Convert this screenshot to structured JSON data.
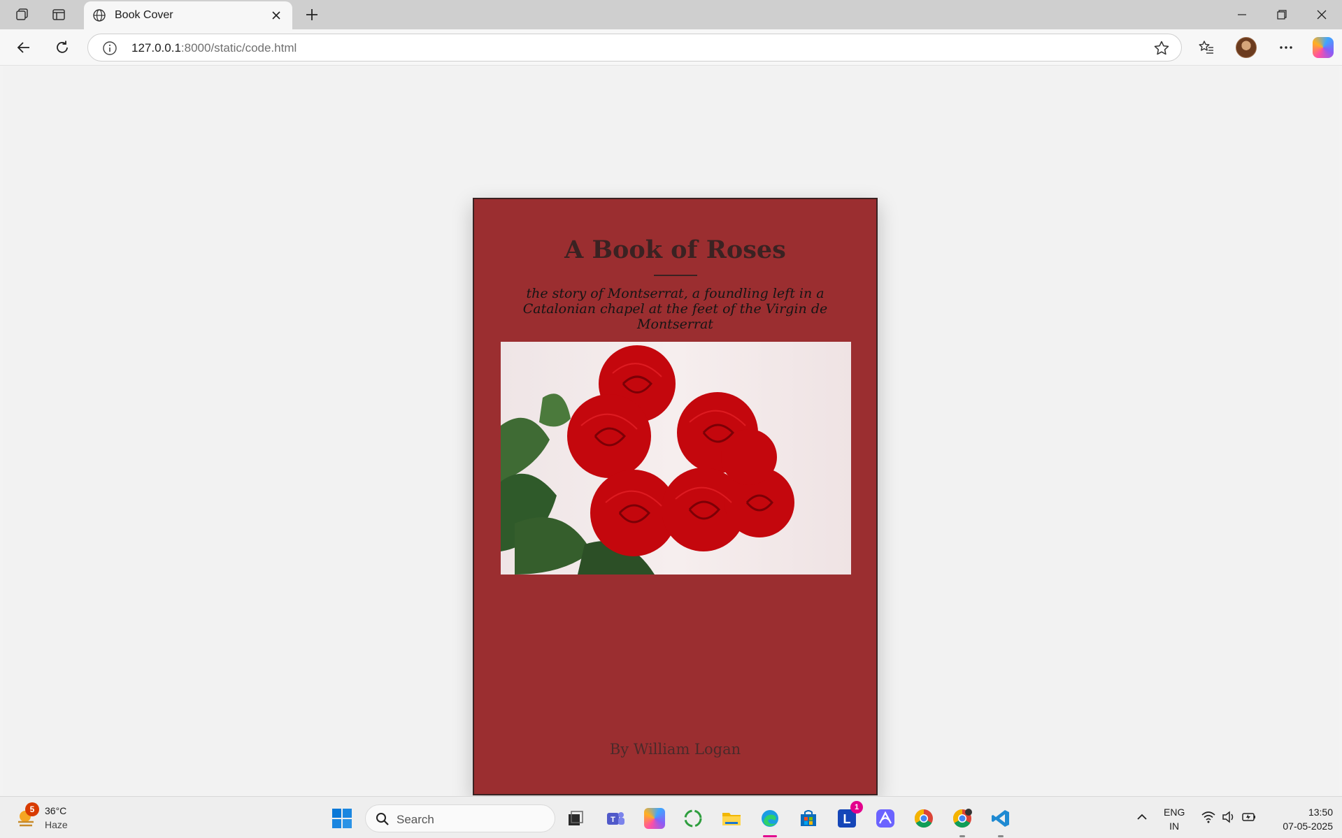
{
  "browser": {
    "tab": {
      "title": "Book Cover"
    },
    "address": {
      "host": "127.0.0.1",
      "rest": ":8000/static/code.html"
    }
  },
  "cover": {
    "background": "#9b2e30",
    "title": "A Book of Roses",
    "subtitle": "the story of Montserrat, a foundling left in a Catalonian chapel at the feet of the Virgin de Montserrat",
    "author": "By William Logan"
  },
  "taskbar": {
    "weather": {
      "badge": "5",
      "temp": "36°C",
      "condition": "Haze"
    },
    "search_placeholder": "Search",
    "apps": [
      {
        "name": "task-view-app",
        "badge": ""
      },
      {
        "name": "teams-app",
        "badge": ""
      },
      {
        "name": "copilot-app",
        "badge": ""
      },
      {
        "name": "sync-app",
        "badge": ""
      },
      {
        "name": "file-explorer-app",
        "badge": ""
      },
      {
        "name": "edge-app",
        "badge": ""
      },
      {
        "name": "store-app",
        "badge": ""
      },
      {
        "name": "l-app",
        "badge": "1"
      },
      {
        "name": "arc-app",
        "badge": ""
      },
      {
        "name": "chrome-app",
        "badge": ""
      },
      {
        "name": "chrome-profile-app",
        "badge": ""
      },
      {
        "name": "vscode-app",
        "badge": ""
      }
    ],
    "lang": {
      "line1": "ENG",
      "line2": "IN"
    },
    "clock": {
      "time": "13:50",
      "date": "07-05-2025"
    }
  }
}
